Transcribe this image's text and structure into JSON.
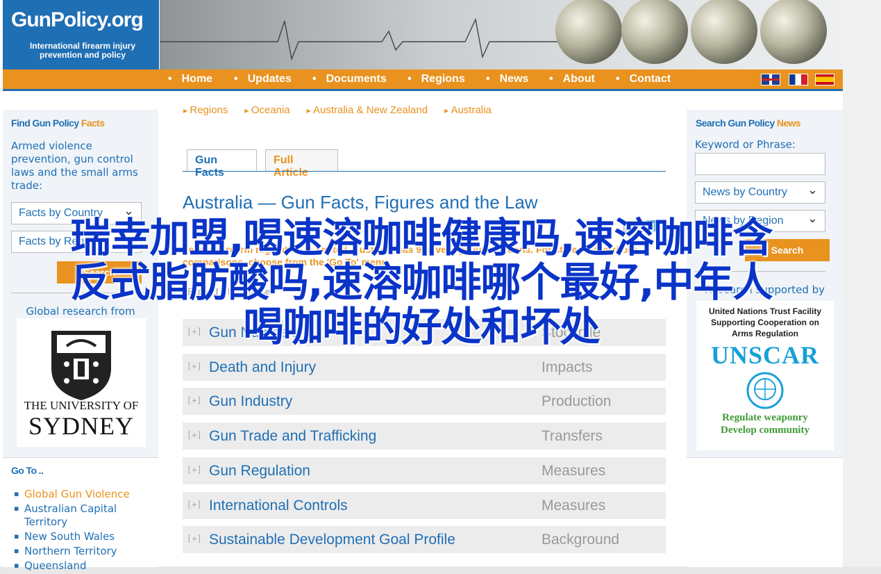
{
  "header": {
    "logo_name": "GunPolicy.org",
    "logo_tagline": "International firearm injury prevention and policy"
  },
  "nav": {
    "items": [
      "Home",
      "Updates",
      "Documents",
      "Regions",
      "News",
      "About",
      "Contact"
    ],
    "languages": [
      "English flag",
      "French flag",
      "Spanish flag"
    ]
  },
  "left": {
    "find_title_a": "Find Gun Policy",
    "find_title_b": "Facts",
    "intro": "Armed violence prevention, gun control laws and the small arms trade:",
    "select_country": "Facts by Country",
    "select_region": "Facts by Region",
    "search_button": "Search",
    "research_from": "Global research from",
    "uni_line1": "THE UNIVERSITY OF",
    "uni_line2": "SYDNEY",
    "goto_title": "Go To ..",
    "goto_items": [
      "Global Gun Violence",
      "Australian Capital Territory",
      "New South Wales",
      "Northern Territory",
      "Queensland"
    ]
  },
  "breadcrumbs": [
    "Regions",
    "Oceania",
    "Australia & New Zealand",
    "Australia"
  ],
  "tabs": {
    "gun_facts": "Gun Facts",
    "full_article": "Full Article"
  },
  "main": {
    "title": "Australia — Gun Facts, Figures and the Law",
    "federal_note": "Federal firearm regulation is limited. Australia has 9 sovereign jurisdictions. For state and territory comparisons, choose from the 'Go To' menu.",
    "expand_collapse": "Expand all / collapse",
    "rows": [
      {
        "label": "Gun Numbers",
        "sub": "Stockpile"
      },
      {
        "label": "Death and Injury",
        "sub": "Impacts"
      },
      {
        "label": "Gun Industry",
        "sub": "Production"
      },
      {
        "label": "Gun Trade and Trafficking",
        "sub": "Transfers"
      },
      {
        "label": "Gun Regulation",
        "sub": "Measures"
      },
      {
        "label": "International Controls",
        "sub": "Measures"
      },
      {
        "label": "Sustainable Development Goal Profile",
        "sub": "Background"
      }
    ]
  },
  "right": {
    "search_title_a": "Search Gun Policy",
    "search_title_b": "News",
    "keyword_label": "Keyword or Phrase:",
    "select_country": "News by Country",
    "select_region": "News by Region",
    "search_button": "Search",
    "supported_by": "Research supported by",
    "unscar_line1": "United Nations Trust Facility",
    "unscar_line2": "Supporting Cooperation on",
    "unscar_line3": "Arms Regulation",
    "unscar": "UNSCAR",
    "unscar_slogan1": "Regulate weaponry",
    "unscar_slogan2": "Develop community"
  },
  "watermark": {
    "line1": "瑞幸加盟,喝速溶咖啡健康吗,速溶咖啡含",
    "line2": "反式脂肪酸吗,速溶咖啡哪个最好,中年人",
    "line3": "喝咖啡的好处和坏处"
  },
  "colors": {
    "brand_blue": "#1f6fb4",
    "accent_orange": "#e9921f",
    "watermark_blue": "#0a34c8"
  }
}
